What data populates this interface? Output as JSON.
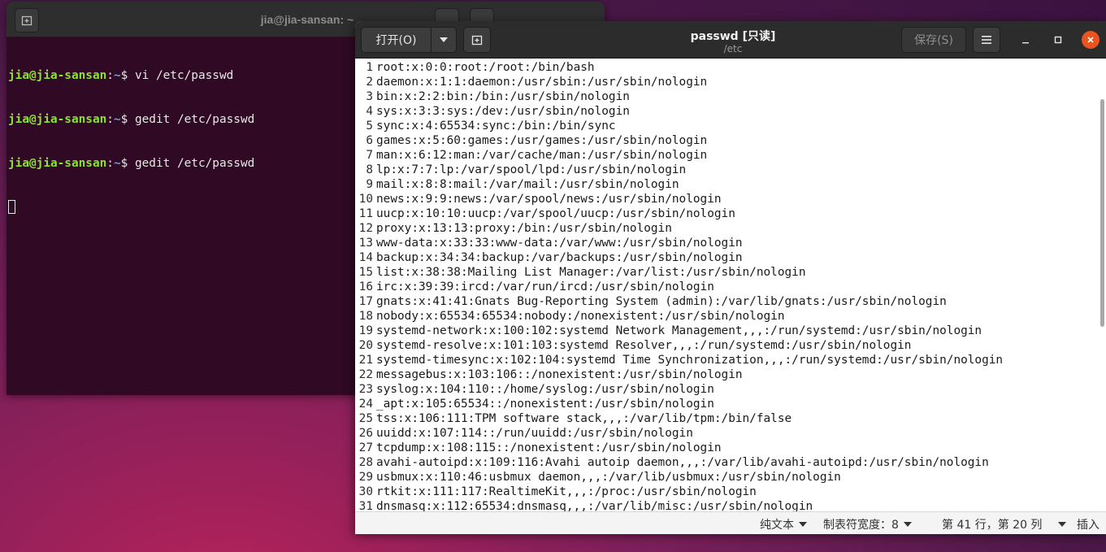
{
  "terminal": {
    "title": "jia@jia-sansan: ~",
    "prompt_user": "jia@jia-sansan",
    "prompt_path": "~",
    "prompt_symbol": "$",
    "commands": [
      "vi /etc/passwd",
      "gedit /etc/passwd",
      "gedit /etc/passwd"
    ]
  },
  "gedit": {
    "open_label": "打开(O)",
    "title": "passwd [只读]",
    "subtitle": "/etc",
    "save_label": "保存(S)",
    "lines": [
      {
        "n": "1",
        "text": "root:x:0:0:root:/root:/bin/bash"
      },
      {
        "n": "2",
        "text": "daemon:x:1:1:daemon:/usr/sbin:/usr/sbin/nologin"
      },
      {
        "n": "3",
        "text": "bin:x:2:2:bin:/bin:/usr/sbin/nologin"
      },
      {
        "n": "4",
        "text": "sys:x:3:3:sys:/dev:/usr/sbin/nologin"
      },
      {
        "n": "5",
        "text": "sync:x:4:65534:sync:/bin:/bin/sync"
      },
      {
        "n": "6",
        "text": "games:x:5:60:games:/usr/games:/usr/sbin/nologin"
      },
      {
        "n": "7",
        "text": "man:x:6:12:man:/var/cache/man:/usr/sbin/nologin"
      },
      {
        "n": "8",
        "text": "lp:x:7:7:lp:/var/spool/lpd:/usr/sbin/nologin"
      },
      {
        "n": "9",
        "text": "mail:x:8:8:mail:/var/mail:/usr/sbin/nologin"
      },
      {
        "n": "10",
        "text": "news:x:9:9:news:/var/spool/news:/usr/sbin/nologin"
      },
      {
        "n": "11",
        "text": "uucp:x:10:10:uucp:/var/spool/uucp:/usr/sbin/nologin"
      },
      {
        "n": "12",
        "text": "proxy:x:13:13:proxy:/bin:/usr/sbin/nologin"
      },
      {
        "n": "13",
        "text": "www-data:x:33:33:www-data:/var/www:/usr/sbin/nologin"
      },
      {
        "n": "14",
        "text": "backup:x:34:34:backup:/var/backups:/usr/sbin/nologin"
      },
      {
        "n": "15",
        "text": "list:x:38:38:Mailing List Manager:/var/list:/usr/sbin/nologin"
      },
      {
        "n": "16",
        "text": "irc:x:39:39:ircd:/var/run/ircd:/usr/sbin/nologin"
      },
      {
        "n": "17",
        "text": "gnats:x:41:41:Gnats Bug-Reporting System (admin):/var/lib/gnats:/usr/sbin/nologin"
      },
      {
        "n": "18",
        "text": "nobody:x:65534:65534:nobody:/nonexistent:/usr/sbin/nologin"
      },
      {
        "n": "19",
        "text": "systemd-network:x:100:102:systemd Network Management,,,:/run/systemd:/usr/sbin/nologin"
      },
      {
        "n": "20",
        "text": "systemd-resolve:x:101:103:systemd Resolver,,,:/run/systemd:/usr/sbin/nologin"
      },
      {
        "n": "21",
        "text": "systemd-timesync:x:102:104:systemd Time Synchronization,,,:/run/systemd:/usr/sbin/nologin"
      },
      {
        "n": "22",
        "text": "messagebus:x:103:106::/nonexistent:/usr/sbin/nologin"
      },
      {
        "n": "23",
        "text": "syslog:x:104:110::/home/syslog:/usr/sbin/nologin"
      },
      {
        "n": "24",
        "text": "_apt:x:105:65534::/nonexistent:/usr/sbin/nologin"
      },
      {
        "n": "25",
        "text": "tss:x:106:111:TPM software stack,,,:/var/lib/tpm:/bin/false"
      },
      {
        "n": "26",
        "text": "uuidd:x:107:114::/run/uuidd:/usr/sbin/nologin"
      },
      {
        "n": "27",
        "text": "tcpdump:x:108:115::/nonexistent:/usr/sbin/nologin"
      },
      {
        "n": "28",
        "text": "avahi-autoipd:x:109:116:Avahi autoip daemon,,,:/var/lib/avahi-autoipd:/usr/sbin/nologin"
      },
      {
        "n": "29",
        "text": "usbmux:x:110:46:usbmux daemon,,,:/var/lib/usbmux:/usr/sbin/nologin"
      },
      {
        "n": "30",
        "text": "rtkit:x:111:117:RealtimeKit,,,:/proc:/usr/sbin/nologin"
      },
      {
        "n": "31",
        "text": "dnsmasq:x:112:65534:dnsmasq,,,:/var/lib/misc:/usr/sbin/nologin"
      }
    ],
    "status": {
      "language": "纯文本",
      "tab_width": "制表符宽度：8",
      "position": "第 41 行，第 20 列",
      "mode": "插入"
    }
  },
  "colors": {
    "terminal_bg": "#300a24",
    "prompt_user": "#8ae234",
    "prompt_path": "#729fcf",
    "close_button": "#e95420"
  }
}
